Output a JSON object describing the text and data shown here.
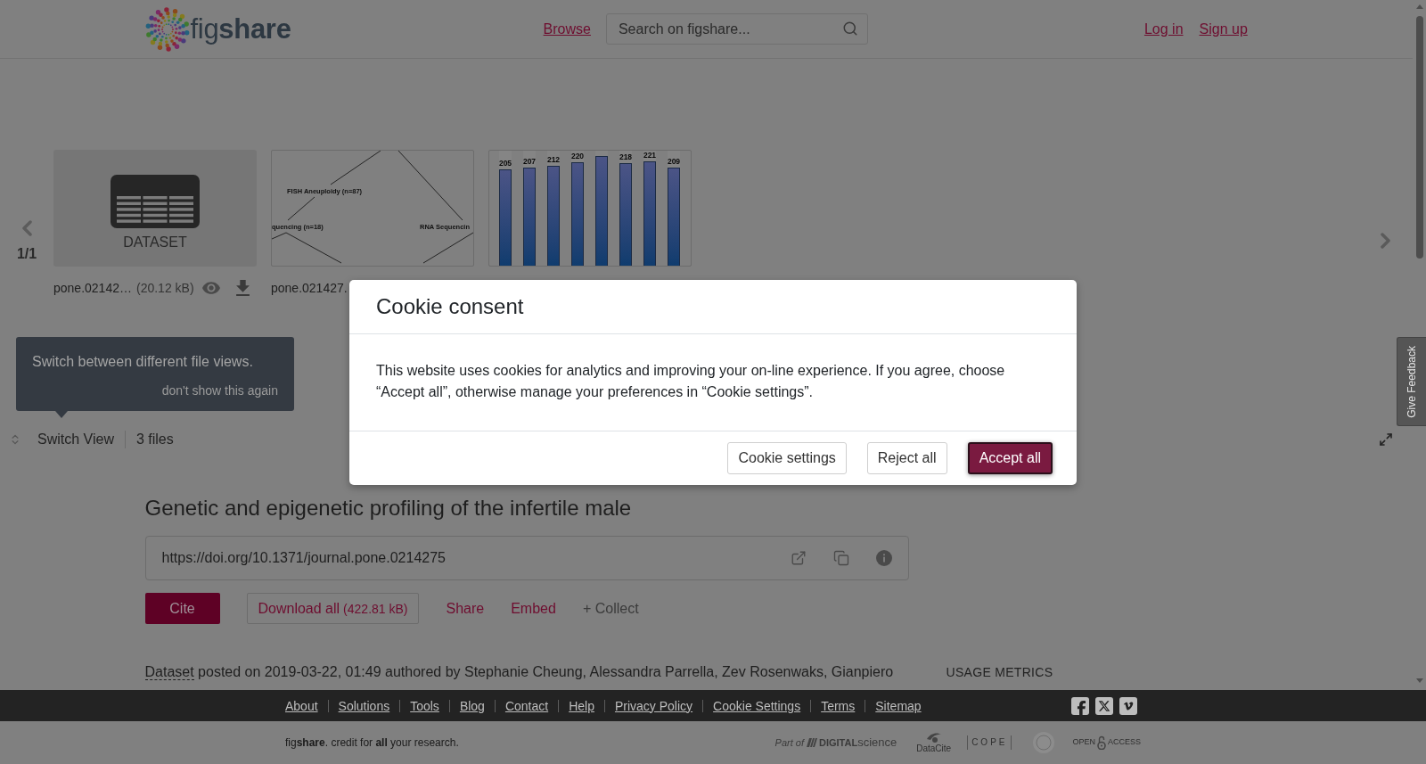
{
  "header": {
    "logo": "fig**share**",
    "nav_link": "Browse",
    "search": {
      "placeholder": "Search on figshare..."
    },
    "auth_links": [
      "Log in",
      "Sign up"
    ]
  },
  "file_viewer": {
    "pager": "1/1",
    "files": [
      {
        "kind": "dataset",
        "label": "DATASET",
        "name": "pone.02142…",
        "size": "(20.12 kB)"
      },
      {
        "kind": "flowchart",
        "texts": [
          "FISH Aneuploidy (n=87)",
          "quencing (n=18)",
          "RNA Sequencin"
        ],
        "name": "pone.021427."
      },
      {
        "kind": "bar_chart",
        "bars": [
          {
            "level": 0.84,
            "label": "205"
          },
          {
            "level": 0.85,
            "label": "207"
          },
          {
            "level": 0.87,
            "label": "212"
          },
          {
            "level": 0.9,
            "label": "220"
          },
          {
            "level": 0.95
          },
          {
            "level": 0.89,
            "label": "218"
          },
          {
            "level": 0.91,
            "label": "221"
          },
          {
            "level": 0.85,
            "label": "209"
          }
        ]
      }
    ],
    "tip": {
      "text": "Switch between different file views.",
      "dismiss": "don't show this again"
    },
    "switch_view": "Switch View",
    "file_count": "3 files"
  },
  "feedback_tab": "Give Feedback",
  "item": {
    "title": "Genetic and epigenetic profiling of the infertile male",
    "doi": "https://doi.org/10.1371/journal.pone.0214275",
    "actions": [
      {
        "kind": "primary",
        "label": "Cite"
      },
      {
        "kind": "outline",
        "label": "Download all",
        "note": "(422.81 kB)"
      },
      {
        "kind": "link",
        "label": "Share"
      },
      {
        "kind": "link",
        "label": "Embed"
      },
      {
        "kind": "muted",
        "label": "+ Collect"
      }
    ],
    "byline": {
      "type_link": "Dataset",
      "text": "posted on 2019-03-22, 01:49 authored by Stephanie Cheung, Alessandra Parrella, Zev Rosenwaks, Gianpiero"
    },
    "usage_metrics": "USAGE METRICS"
  },
  "cookie_dialog": {
    "title": "Cookie consent",
    "body": "This website uses cookies for analytics and improving your on-line experience. If you agree, choose “Accept all”, otherwise manage your preferences in “Cookie settings”.",
    "buttons": [
      {
        "label": "Cookie settings",
        "kind": "secondary",
        "focused": false
      },
      {
        "label": "Reject all",
        "kind": "secondary",
        "focused": false
      },
      {
        "label": "Accept all",
        "kind": "primary",
        "focused": true
      }
    ]
  },
  "footer": {
    "links": [
      "About",
      "Solutions",
      "Tools",
      "Blog",
      "Contact",
      "Help",
      "Privacy Policy",
      "Cookie Settings",
      "Terms",
      "Sitemap"
    ],
    "tagline": "fig**share**. credit for **all** your research.",
    "partners": [
      {
        "kind": "digital_science",
        "prefix": "Part of",
        "name": "**DIGITAL**science"
      },
      {
        "kind": "datacite",
        "name": "DataCite"
      },
      {
        "kind": "cope",
        "name": "COPE"
      },
      {
        "kind": "seal"
      },
      {
        "kind": "open_access",
        "left": "OPEN",
        "right": "ACCESS"
      }
    ]
  }
}
